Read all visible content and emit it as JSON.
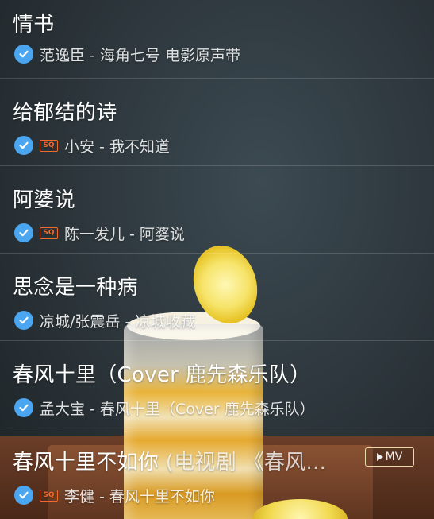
{
  "songs": [
    {
      "title": "情书",
      "title_extra": "",
      "sq": false,
      "meta": "范逸臣 - 海角七号 电影原声带"
    },
    {
      "title": "给郁结的诗",
      "title_extra": "",
      "sq": true,
      "meta": "小安 - 我不知道"
    },
    {
      "title": "阿婆说",
      "title_extra": "",
      "sq": true,
      "meta": "陈一发儿 - 阿婆说"
    },
    {
      "title": "思念是一种病",
      "title_extra": "",
      "sq": false,
      "meta": "凉城/张震岳 - 凉城收藏"
    },
    {
      "title": "春风十里（Cover 鹿先森乐队）",
      "title_extra": "",
      "sq": false,
      "meta": "孟大宝 - 春风十里（Cover 鹿先森乐队）"
    },
    {
      "title": "春风十里不如你",
      "title_extra": " (电视剧 《春风...",
      "sq": true,
      "meta": "李健 - 春风十里不如你"
    }
  ],
  "badges": {
    "sq_label": "SQ",
    "mv_label": "MV"
  },
  "icons": {
    "check": "check-circle-icon",
    "sq": "sq-quality-icon",
    "mv": "play-icon"
  },
  "colors": {
    "check_blue": "#4aa6f0",
    "sq_orange": "#f06a2e"
  }
}
